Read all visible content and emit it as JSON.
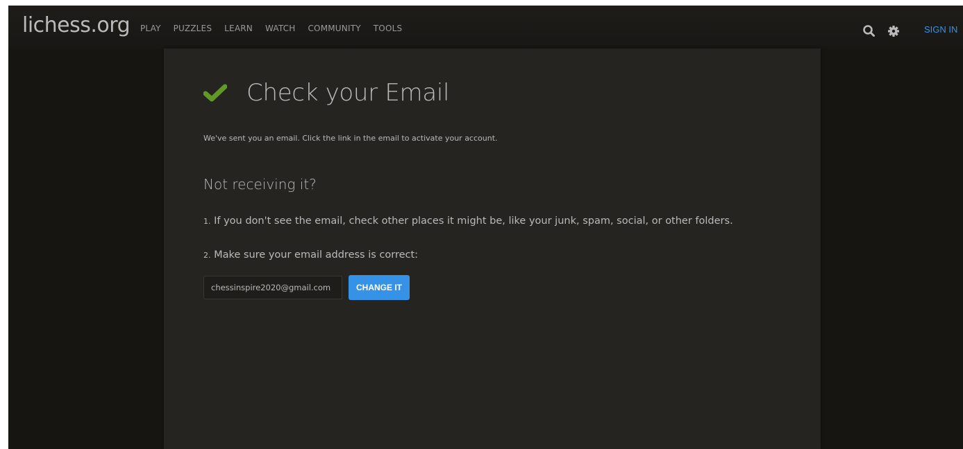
{
  "header": {
    "logo": "lichess.org",
    "nav": [
      "PLAY",
      "PUZZLES",
      "LEARN",
      "WATCH",
      "COMMUNITY",
      "TOOLS"
    ],
    "signin_label": "SIGN IN",
    "icons": [
      "search-icon",
      "gear-icon"
    ]
  },
  "main": {
    "title": "Check your Email",
    "intro": "We've sent you an email. Click the link in the email to activate your account.",
    "subtitle": "Not receiving it?",
    "step1_num": "1.",
    "step1_text": " If you don't see the email, check other places it might be, like your junk, spam, social, or other folders.",
    "step2_num": "2.",
    "step2_text": " Make sure your email address is correct:",
    "email_value": "chessinspire2020@gmail.com",
    "change_label": "CHANGE IT"
  },
  "colors": {
    "background": "#161512",
    "panel": "#262421",
    "text": "#bababa",
    "accent": "#3692e7",
    "check": "#629924"
  }
}
